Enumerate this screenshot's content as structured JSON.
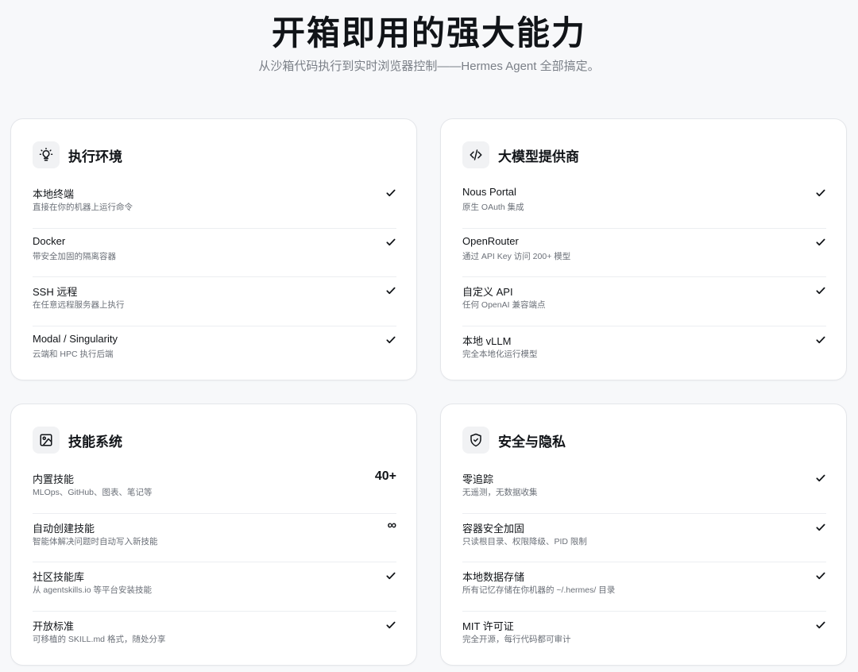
{
  "hero": {
    "title": "开箱即用的强大能力",
    "subtitle": "从沙箱代码执行到实时浏览器控制——Hermes Agent 全部搞定。"
  },
  "cards": [
    {
      "title": "执行环境",
      "icon": "lightbulb-icon",
      "items": [
        {
          "label": "本地终端",
          "desc": "直接在你的机器上运行命令",
          "mark": "check"
        },
        {
          "label": "Docker",
          "desc": "带安全加固的隔离容器",
          "mark": "check"
        },
        {
          "label": "SSH 远程",
          "desc": "在任意远程服务器上执行",
          "mark": "check"
        },
        {
          "label": "Modal / Singularity",
          "desc": "云端和 HPC 执行后端",
          "mark": "check"
        }
      ]
    },
    {
      "title": "大模型提供商",
      "icon": "code-icon",
      "items": [
        {
          "label": "Nous Portal",
          "desc": "原生 OAuth 集成",
          "mark": "check"
        },
        {
          "label": "OpenRouter",
          "desc": "通过 API Key 访问 200+ 模型",
          "mark": "check"
        },
        {
          "label": "自定义 API",
          "desc": "任何 OpenAI 兼容端点",
          "mark": "check"
        },
        {
          "label": "本地 vLLM",
          "desc": "完全本地化运行模型",
          "mark": "check"
        }
      ]
    },
    {
      "title": "技能系统",
      "icon": "image-icon",
      "items": [
        {
          "label": "内置技能",
          "desc": "MLOps、GitHub、图表、笔记等",
          "mark": "text",
          "value": "40+"
        },
        {
          "label": "自动创建技能",
          "desc": "智能体解决问题时自动写入新技能",
          "mark": "text",
          "value": "∞"
        },
        {
          "label": "社区技能库",
          "desc": "从 agentskills.io 等平台安装技能",
          "mark": "check"
        },
        {
          "label": "开放标准",
          "desc": "可移植的 SKILL.md 格式，随处分享",
          "mark": "check"
        }
      ]
    },
    {
      "title": "安全与隐私",
      "icon": "shield-check-icon",
      "items": [
        {
          "label": "零追踪",
          "desc": "无遥测，无数据收集",
          "mark": "check"
        },
        {
          "label": "容器安全加固",
          "desc": "只读根目录、权限降级、PID 限制",
          "mark": "check"
        },
        {
          "label": "本地数据存储",
          "desc": "所有记忆存储在你机器的 ~/.hermes/ 目录",
          "mark": "check"
        },
        {
          "label": "MIT 许可证",
          "desc": "完全开源，每行代码都可审计",
          "mark": "check"
        }
      ]
    }
  ]
}
